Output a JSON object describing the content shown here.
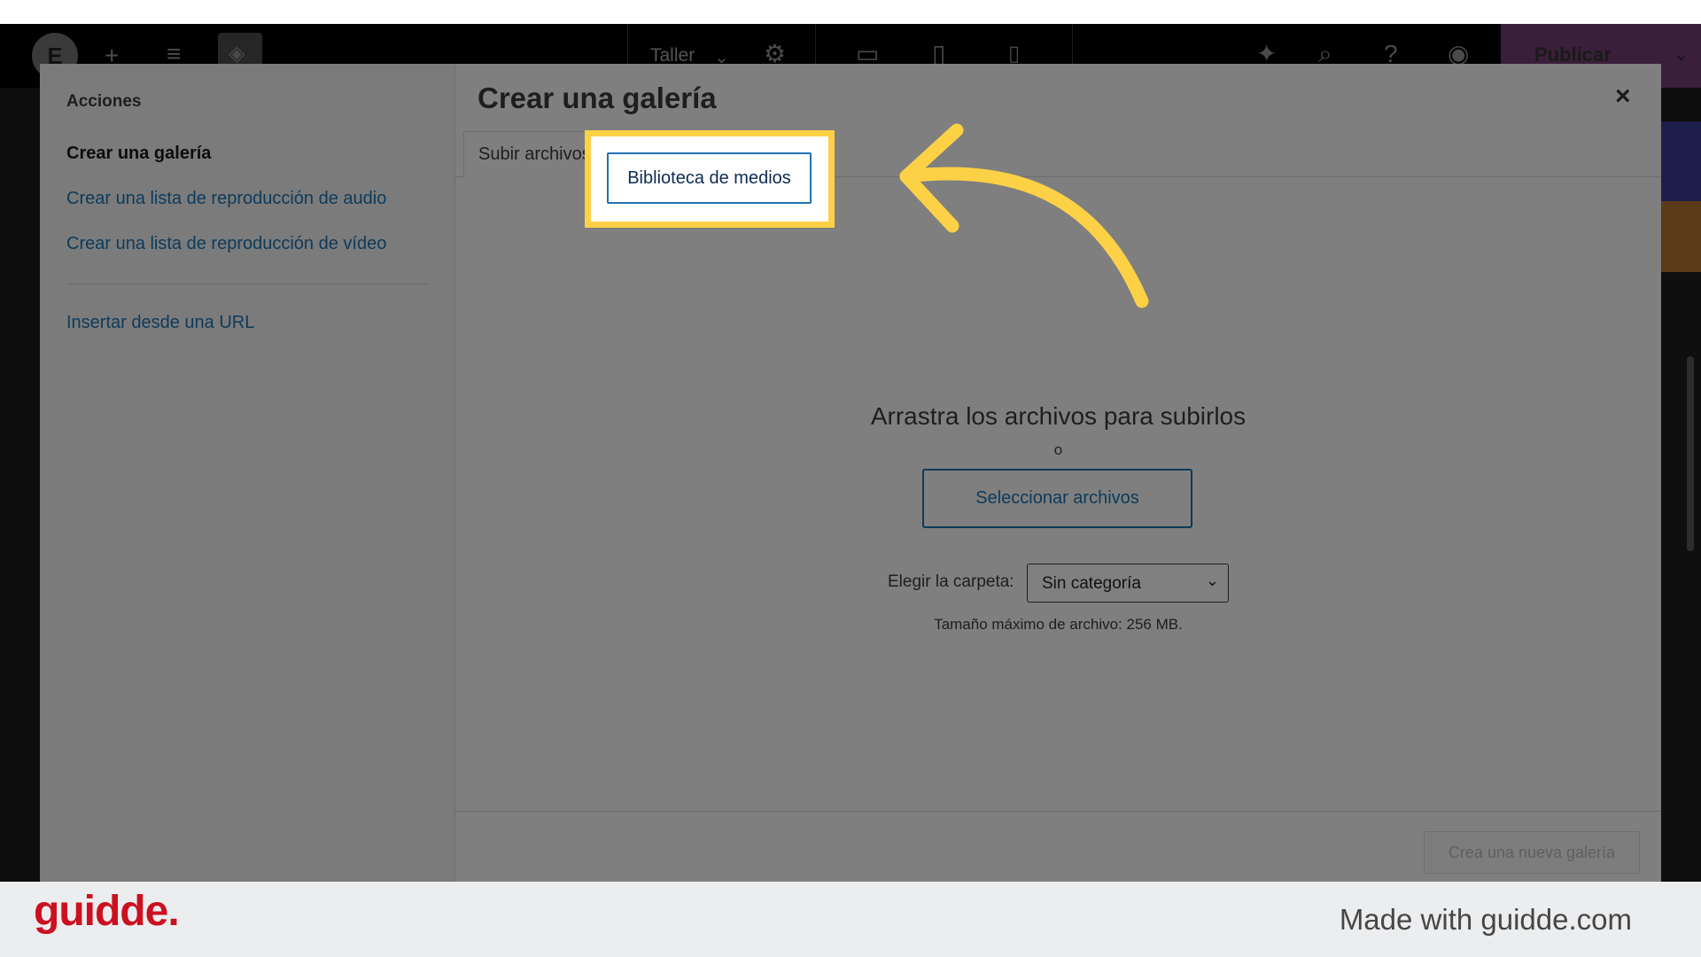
{
  "topbar": {
    "page_name": "Taller",
    "publish_label": "Publicar"
  },
  "menu": {
    "heading": "Acciones",
    "items": [
      {
        "label": "Crear una galería",
        "active": true
      },
      {
        "label": "Crear una lista de reproducción de audio",
        "active": false
      },
      {
        "label": "Crear una lista de reproducción de vídeo",
        "active": false
      }
    ],
    "url_item": "Insertar desde una URL"
  },
  "frame": {
    "title": "Crear una galería",
    "close_glyph": "×",
    "tabs": [
      {
        "label": "Subir archivos"
      },
      {
        "label": "Biblioteca de medios",
        "highlighted": true
      }
    ]
  },
  "uploader": {
    "title": "Arrastra los archivos para subirlos",
    "or": "o",
    "select_button": "Seleccionar archivos",
    "folder_label": "Elegir la carpeta:",
    "folder_value": "Sin categoría",
    "max_size": "Tamaño máximo de archivo: 256 MB."
  },
  "toolbar": {
    "create_button": "Crea una nueva galería"
  },
  "footer": {
    "brand": "guidde.",
    "made_with": "Made with guidde.com"
  },
  "colors": {
    "highlight": "#fdd146",
    "brand": "#cc1020",
    "link": "#2271b1"
  }
}
